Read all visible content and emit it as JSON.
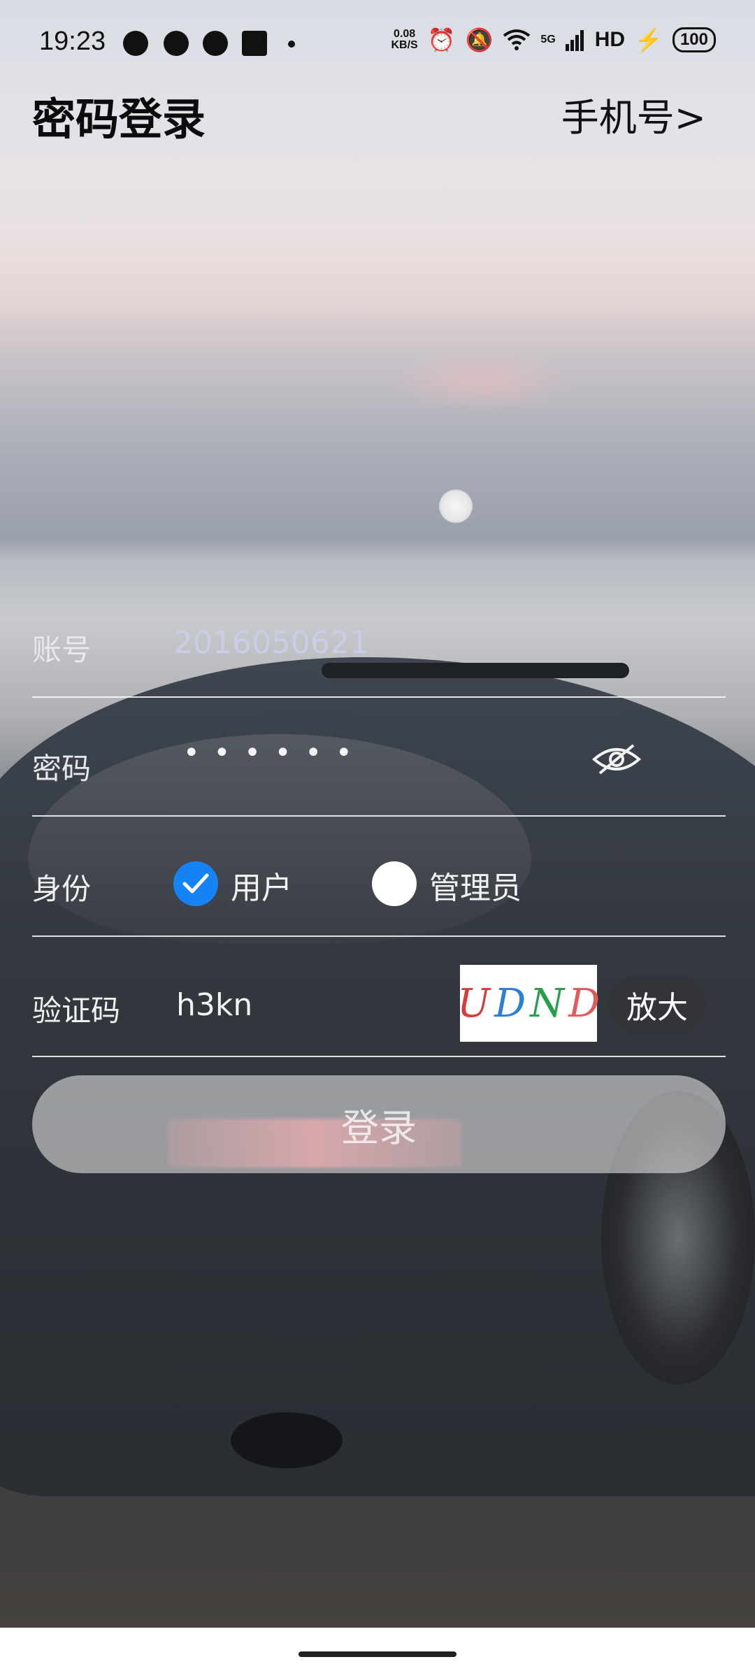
{
  "status_bar": {
    "time": "19:23",
    "net_speed_value": "0.08",
    "net_speed_unit": "KB/S",
    "signal_label": "5G",
    "hd_label": "HD",
    "battery": "100"
  },
  "header": {
    "title": "密码登录",
    "switch_link": "手机号>"
  },
  "form": {
    "account_label": "账号",
    "account_value": "2016050621",
    "password_label": "密码",
    "password_masked": "••••••",
    "identity_label": "身份",
    "identity_options": [
      {
        "label": "用户",
        "selected": true
      },
      {
        "label": "管理员",
        "selected": false
      }
    ],
    "captcha_label": "验证码",
    "captcha_value": "h3kn",
    "captcha_image_text": [
      "U",
      "D",
      "N",
      "D"
    ],
    "zoom_button": "放大",
    "login_button": "登录"
  },
  "colors": {
    "accent": "#1683f5",
    "text_light": "#f3f3f3"
  },
  "icons": [
    "message-icon",
    "chat-icon",
    "wechat-icon",
    "toutiao-icon",
    "alarm-icon",
    "mute-icon",
    "wifi-icon",
    "signal-icon",
    "charging-icon",
    "eye-off-icon",
    "check-icon"
  ]
}
